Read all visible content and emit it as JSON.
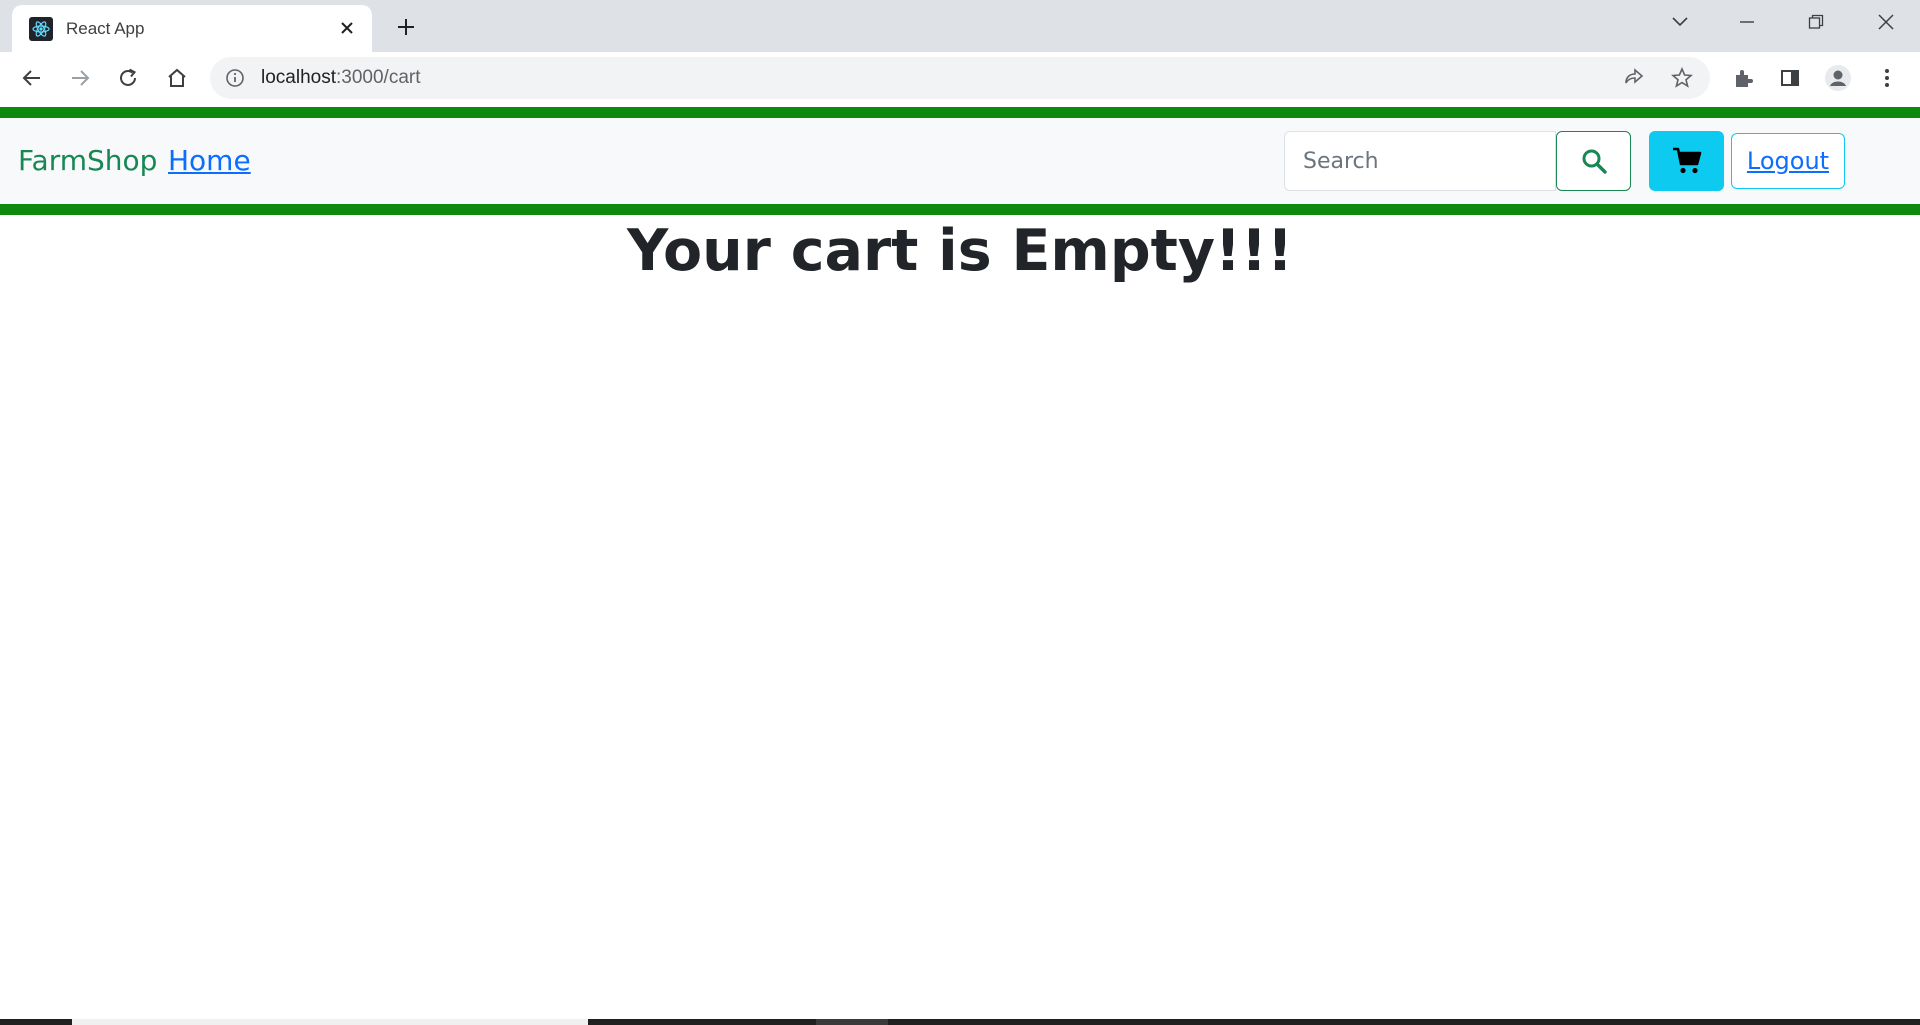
{
  "browser": {
    "tab_title": "React App",
    "url_host": "localhost",
    "url_path": ":3000/cart"
  },
  "navbar": {
    "brand": "FarmShop",
    "home_label": "Home",
    "search_placeholder": "Search",
    "logout_label": "Logout"
  },
  "colors": {
    "green_bar": "#0d8a0d",
    "brand_text": "#198754",
    "link": "#0d6efd",
    "cart_button": "#0dcaf0"
  },
  "main": {
    "heading": "Your cart is Empty!!!"
  }
}
